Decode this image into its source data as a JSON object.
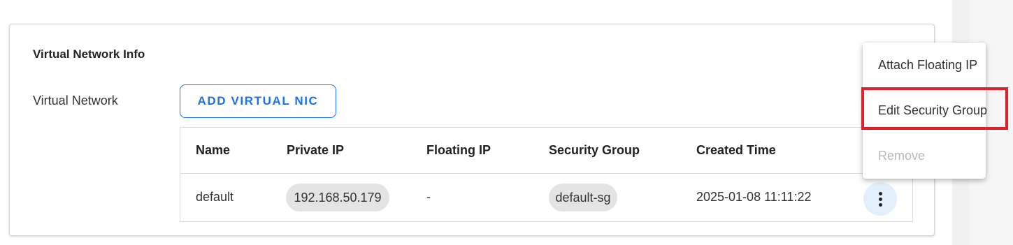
{
  "card": {
    "title": "Virtual Network Info",
    "field_label": "Virtual Network",
    "add_button_label": "ADD VIRTUAL NIC"
  },
  "table": {
    "headers": [
      "Name",
      "Private IP",
      "Floating IP",
      "Security Group",
      "Created Time"
    ],
    "rows": [
      {
        "name": "default",
        "private_ip": "192.168.50.179",
        "floating_ip": "-",
        "security_group": "default-sg",
        "created_time": "2025-01-08 11:11:22"
      }
    ]
  },
  "row_actions_icon": "more-vertical-icon",
  "menu": {
    "items": [
      {
        "label": "Attach Floating IP",
        "disabled": false
      },
      {
        "label": "Edit Security Group",
        "disabled": false,
        "highlighted": true
      },
      {
        "label": "Remove",
        "disabled": true
      }
    ]
  },
  "colors": {
    "accent": "#1a73e8",
    "highlight": "#e0202a",
    "chip_bg": "#e4e4e4",
    "kebab_bg": "#e3f0fb"
  }
}
